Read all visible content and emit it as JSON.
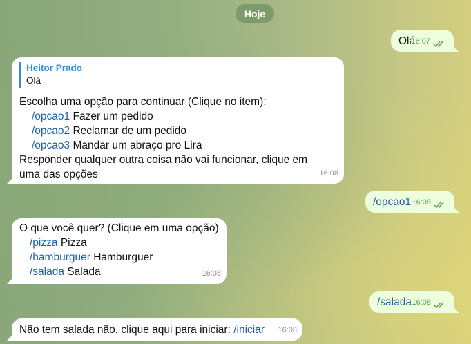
{
  "date_label": "Hoje",
  "messages": [
    {
      "text": "Olá",
      "time": "16:07"
    },
    {
      "reply_name": "Heitor Prado",
      "reply_text": "Olá",
      "intro": "Escolha uma opção para continuar (Clique no item):",
      "options": [
        {
          "cmd": "/opcao1",
          "label": "Fazer um pedido"
        },
        {
          "cmd": "/opcao2",
          "label": "Reclamar de um pedido"
        },
        {
          "cmd": "/opcao3",
          "label": "Mandar um abraço pro Lira"
        }
      ],
      "footer": "Responder qualquer outra coisa não vai funcionar, clique em uma das opções",
      "time": "16:08"
    },
    {
      "text": "/opcao1",
      "time": "16:08"
    },
    {
      "intro": "O que você quer? (Clique em uma opção)",
      "options": [
        {
          "cmd": "/pizza",
          "label": "Pizza"
        },
        {
          "cmd": "/hamburguer",
          "label": "Hamburguer"
        },
        {
          "cmd": "/salada",
          "label": "Salada"
        }
      ],
      "time": "16:08"
    },
    {
      "text": "/salada",
      "time": "16:08"
    },
    {
      "text": "Não tem salada não, clique aqui para iniciar:",
      "cmd": "/iniciar",
      "time": "16:08"
    }
  ]
}
